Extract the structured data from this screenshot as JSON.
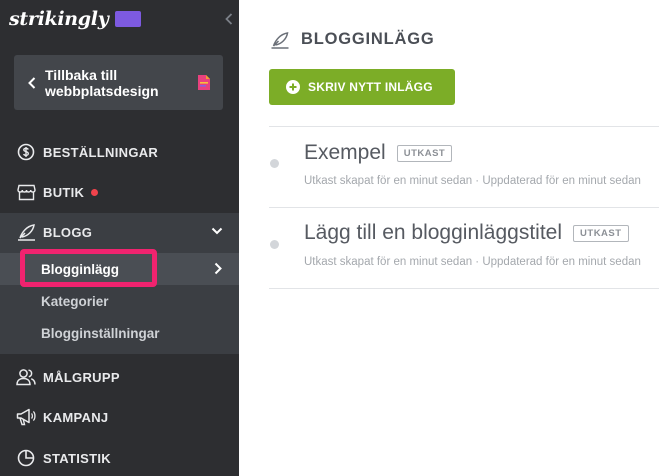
{
  "sidebar": {
    "logo": "strikingly",
    "back_button": "Tillbaka till webbplatsdesign",
    "nav": {
      "orders": "BESTÄLLNINGAR",
      "shop": "BUTIK",
      "blog": "BLOGG",
      "audience": "MÅLGRUPP",
      "campaign": "KAMPANJ",
      "stats": "STATISTIK"
    },
    "blog_sub": {
      "posts": "Blogginlägg",
      "categories": "Kategorier",
      "settings": "Blogginställningar"
    }
  },
  "main": {
    "title": "BLOGGINLÄGG",
    "new_post_button": "SKRIV NYTT INLÄGG",
    "posts": [
      {
        "title": "Exempel",
        "status": "UTKAST",
        "meta": "Utkast skapat för en minut sedan · Uppdaterad för en minut sedan"
      },
      {
        "title": "Lägg till en blogginläggstitel",
        "status": "UTKAST",
        "meta": "Utkast skapat för en minut sedan · Uppdaterad för en minut sedan"
      }
    ]
  },
  "colors": {
    "sidebar_bg": "#2d2e31",
    "accent_green": "#7cad27",
    "highlight_pink": "#f0236f",
    "logo_purple": "#7d5ae0",
    "notification_red": "#f0434c"
  }
}
